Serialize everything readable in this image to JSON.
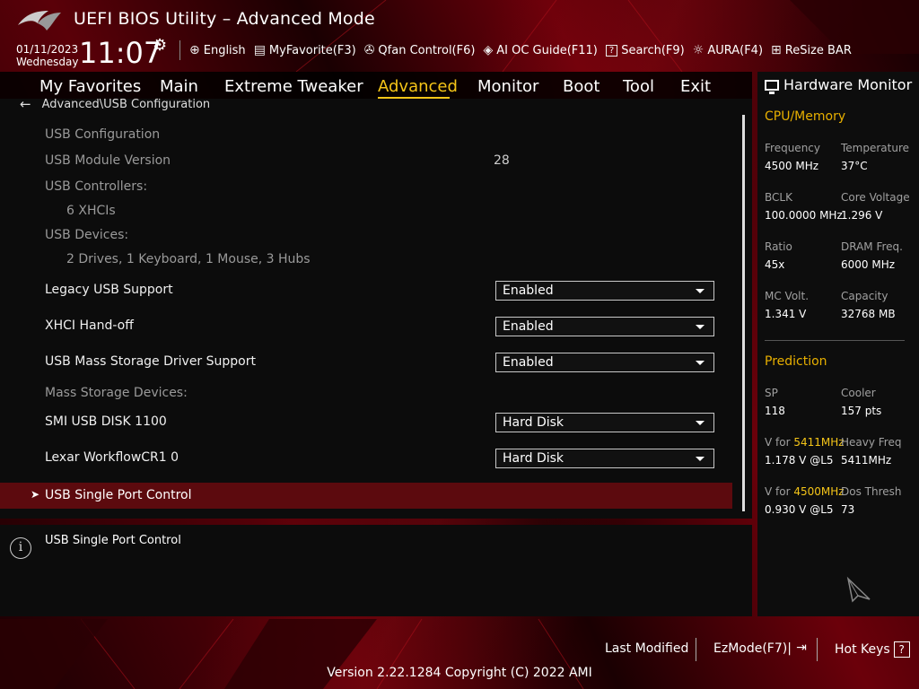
{
  "header": {
    "title": "UEFI BIOS Utility – Advanced Mode",
    "date": "01/11/2023",
    "day": "Wednesday",
    "time": "11:07"
  },
  "toolbar": [
    {
      "icon": "globe-icon",
      "glyph": "🌐",
      "label": "English"
    },
    {
      "icon": "favorite-icon",
      "glyph": "▤",
      "label": "MyFavorite(F3)"
    },
    {
      "icon": "fan-icon",
      "glyph": "✇",
      "label": "Qfan Control(F6)"
    },
    {
      "icon": "ai-chip-icon",
      "glyph": "◈",
      "label": "AI OC Guide(F11)"
    },
    {
      "icon": "search-icon",
      "glyph": "?",
      "label": "Search(F9)"
    },
    {
      "icon": "aura-icon",
      "glyph": "☼",
      "label": "AURA(F4)"
    },
    {
      "icon": "resize-bar-icon",
      "glyph": "⊞",
      "label": "ReSize BAR"
    }
  ],
  "tabs": [
    {
      "label": "My Favorites"
    },
    {
      "label": "Main"
    },
    {
      "label": "Extreme Tweaker"
    },
    {
      "label": "Advanced",
      "active": true
    },
    {
      "label": "Monitor"
    },
    {
      "label": "Boot"
    },
    {
      "label": "Tool"
    },
    {
      "label": "Exit"
    }
  ],
  "breadcrumb": "Advanced\\USB Configuration",
  "settings": {
    "usb_configuration": "USB Configuration",
    "usb_module_version_label": "USB Module Version",
    "usb_module_version_value": "28",
    "usb_controllers_label": "USB Controllers:",
    "usb_controllers_value": "6 XHCIs",
    "usb_devices_label": "USB Devices:",
    "usb_devices_value": "2 Drives, 1 Keyboard, 1 Mouse, 3 Hubs",
    "legacy_usb_label": "Legacy USB Support",
    "legacy_usb_value": "Enabled",
    "xhci_label": "XHCI Hand-off",
    "xhci_value": "Enabled",
    "mass_storage_driver_label": "USB Mass Storage Driver Support",
    "mass_storage_driver_value": "Enabled",
    "mass_storage_devices_label": "Mass Storage Devices:",
    "smi_label": "SMI USB DISK 1100",
    "smi_value": "Hard Disk",
    "lexar_label": "Lexar WorkflowCR1 0",
    "lexar_value": "Hard Disk",
    "single_port_label": "USB Single Port Control"
  },
  "help": {
    "text": "USB Single Port Control"
  },
  "hardware_monitor": {
    "title": "Hardware Monitor",
    "cpu_memory": "CPU/Memory",
    "frequency_label": "Frequency",
    "frequency_value": "4500 MHz",
    "temperature_label": "Temperature",
    "temperature_value": "37°C",
    "bclk_label": "BCLK",
    "bclk_value": "100.0000 MHz",
    "core_voltage_label": "Core Voltage",
    "core_voltage_value": "1.296 V",
    "ratio_label": "Ratio",
    "ratio_value": "45x",
    "dram_freq_label": "DRAM Freq.",
    "dram_freq_value": "6000 MHz",
    "mc_volt_label": "MC Volt.",
    "mc_volt_value": "1.341 V",
    "capacity_label": "Capacity",
    "capacity_value": "32768 MB",
    "prediction": "Prediction",
    "sp_label": "SP",
    "sp_value": "118",
    "cooler_label": "Cooler",
    "cooler_value": "157 pts",
    "vfor1_prefix": "V for ",
    "vfor1_freq": "5411MHz",
    "vfor1_value": "1.178 V @L5",
    "heavy_freq_label": "Heavy Freq",
    "heavy_freq_value": "5411MHz",
    "vfor2_prefix": "V for ",
    "vfor2_freq": "4500MHz",
    "vfor2_value": "0.930 V @L5",
    "dos_thresh_label": "Dos Thresh",
    "dos_thresh_value": "73"
  },
  "footer": {
    "last_modified": "Last Modified",
    "ezmode": "EzMode(F7)|",
    "hot_keys": "Hot Keys",
    "version": "Version 2.22.1284 Copyright (C) 2022 AMI"
  },
  "colors": {
    "accent": "#f5c518",
    "section_heading": "#e8b000",
    "selected_row": "#5c0a0e"
  }
}
